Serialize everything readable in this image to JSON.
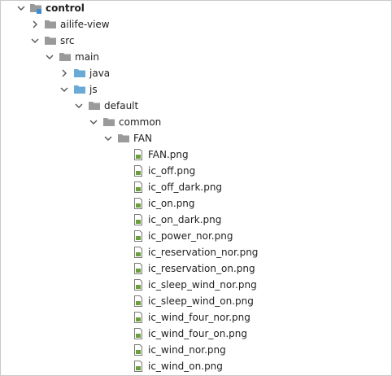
{
  "tree": {
    "root": {
      "label": "control",
      "expanded": true
    },
    "nodes": [
      {
        "label": "ailife-view",
        "type": "folder",
        "expanded": false
      },
      {
        "label": "src",
        "type": "folder",
        "expanded": true
      },
      {
        "label": "main",
        "type": "folder",
        "expanded": true
      },
      {
        "label": "java",
        "type": "source-folder",
        "expanded": false
      },
      {
        "label": "js",
        "type": "source-folder",
        "expanded": true
      },
      {
        "label": "default",
        "type": "folder",
        "expanded": true
      },
      {
        "label": "common",
        "type": "folder",
        "expanded": true
      },
      {
        "label": "FAN",
        "type": "folder",
        "expanded": true
      }
    ],
    "files": [
      "FAN.png",
      "ic_off.png",
      "ic_off_dark.png",
      "ic_on.png",
      "ic_on_dark.png",
      "ic_power_nor.png",
      "ic_reservation_nor.png",
      "ic_reservation_on.png",
      "ic_sleep_wind_nor.png",
      "ic_sleep_wind_on.png",
      "ic_wind_four_nor.png",
      "ic_wind_four_on.png",
      "ic_wind_nor.png",
      "ic_wind_on.png"
    ]
  },
  "colors": {
    "folder": "#9a9a9a",
    "source_folder": "#6aaad6",
    "module_marker": "#3d8fd1",
    "file_stroke": "#7a7a7a",
    "file_green": "#6a9f3a",
    "arrow": "#555555"
  }
}
